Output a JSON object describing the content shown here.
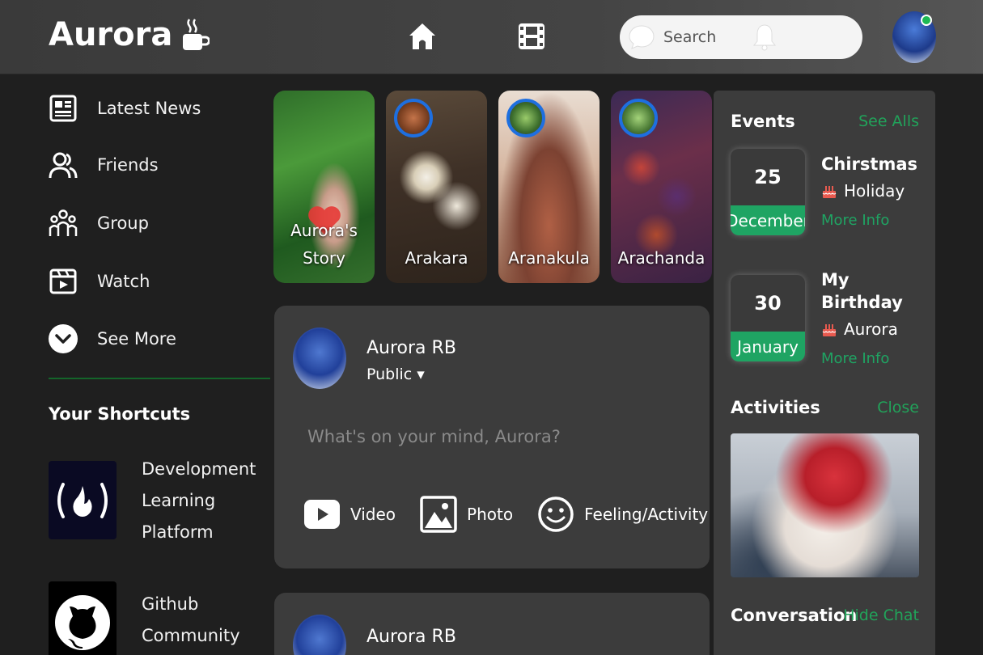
{
  "header": {
    "logo_text": "Aurora",
    "search_placeholder": "Search"
  },
  "sidebar": {
    "items": [
      {
        "label": "Latest News",
        "icon": "newspaper-icon"
      },
      {
        "label": "Friends",
        "icon": "friends-icon"
      },
      {
        "label": "Group",
        "icon": "group-icon"
      },
      {
        "label": "Watch",
        "icon": "watch-icon"
      },
      {
        "label": "See More",
        "icon": "chevron-down-icon"
      }
    ],
    "shortcuts_title": "Your Shortcuts",
    "shortcuts": [
      {
        "lines": [
          "Development",
          "Learning",
          "Platform"
        ],
        "icon": "freecodecamp-icon"
      },
      {
        "lines": [
          "Github",
          "Community"
        ],
        "icon": "github-icon"
      }
    ]
  },
  "stories": [
    {
      "lines": [
        "Aurora's",
        "Story"
      ]
    },
    {
      "lines": [
        "Arakara"
      ]
    },
    {
      "lines": [
        "Aranakula"
      ]
    },
    {
      "lines": [
        "Arachanda"
      ]
    }
  ],
  "composer": {
    "user_name": "Aurora RB",
    "privacy": "Public ▾",
    "placeholder": "What's on your mind, Aurora?",
    "actions": [
      {
        "label": "Video",
        "icon": "video-icon"
      },
      {
        "label": "Photo",
        "icon": "photo-icon"
      },
      {
        "label": "Feeling/Activity",
        "icon": "smiley-icon"
      }
    ]
  },
  "post": {
    "user_name": "Aurora RB"
  },
  "right_panel": {
    "events_title": "Events",
    "events_link": "See Alls",
    "events": [
      {
        "day": "25",
        "month": "December",
        "title_lines": [
          "Chirstmas"
        ],
        "sub": "Holiday",
        "more": "More Info"
      },
      {
        "day": "30",
        "month": "January",
        "title_lines": [
          "My",
          "Birthday"
        ],
        "sub": "Aurora",
        "more": "More Info"
      }
    ],
    "activities_title": "Activities",
    "activities_link": "Close",
    "conversation_title": "Conversation",
    "conversation_link": "Hide Chat"
  },
  "colors": {
    "accent_green": "#1fa463",
    "story_ring": "#1e6fe0",
    "online": "#1db954"
  }
}
